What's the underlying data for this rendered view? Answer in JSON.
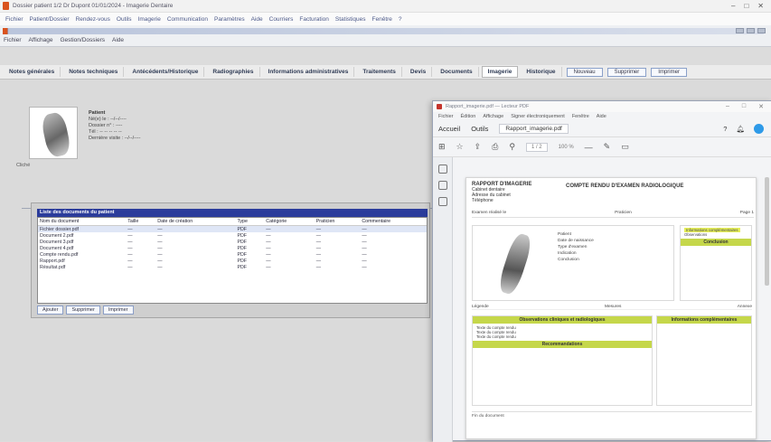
{
  "window": {
    "title": "Dossier patient 1/2 Dr Dupont 01/01/2024 - Imagerie Dentaire",
    "controls": [
      "–",
      "□",
      "✕"
    ]
  },
  "menubar": {
    "items": [
      "Fichier",
      "Patient/Dossier",
      "Rendez-vous",
      "Outils",
      "Imagerie",
      "Communication",
      "Paramètres",
      "Aide",
      "Courriers",
      "Facturation",
      "Statistiques",
      "Fenêtre",
      "?"
    ]
  },
  "toolbar": {
    "submenu": [
      "Fichier",
      "Affichage",
      "Gestion/Dossiers",
      "Aide"
    ]
  },
  "tabs": {
    "items": [
      "Notes générales",
      "Notes techniques",
      "Antécédents/Historique",
      "Radiographies",
      "Informations administratives",
      "Traitements",
      "Devis",
      "Documents",
      "Imagerie",
      "Historique"
    ],
    "buttons": [
      "Nouveau",
      "Supprimer",
      "Imprimer"
    ],
    "active_index": 8
  },
  "patient": {
    "name": "Patient",
    "lines": [
      "Né(e) le : --/--/----",
      "Dossier n° : ----",
      "Tél : -- -- -- -- --",
      "Dernière visite : --/--/----"
    ],
    "photo_caption": "Cliché"
  },
  "documents_panel": {
    "header": "Liste des documents du patient",
    "columns": [
      "Nom du document",
      "Taille",
      "Date de création",
      "Type",
      "Catégorie",
      "Praticien",
      "Commentaire"
    ],
    "rows": [
      [
        "Fichier dossier.pdf",
        "—",
        "—",
        "PDF",
        "—",
        "—",
        "—"
      ],
      [
        "Document 2.pdf",
        "—",
        "—",
        "PDF",
        "—",
        "—",
        "—"
      ],
      [
        "Document 3.pdf",
        "—",
        "—",
        "PDF",
        "—",
        "—",
        "—"
      ],
      [
        "Document 4.pdf",
        "—",
        "—",
        "PDF",
        "—",
        "—",
        "—"
      ],
      [
        "Compte rendu.pdf",
        "—",
        "—",
        "PDF",
        "—",
        "—",
        "—"
      ],
      [
        "Rapport.pdf",
        "—",
        "—",
        "PDF",
        "—",
        "—",
        "—"
      ],
      [
        "Résultat.pdf",
        "—",
        "—",
        "PDF",
        "—",
        "—",
        "—"
      ]
    ],
    "buttons": [
      "Ajouter",
      "Supprimer",
      "Imprimer"
    ]
  },
  "pdf_viewer": {
    "title": "Rapport_imagerie.pdf — Lecteur PDF",
    "menu": [
      "Fichier",
      "Édition",
      "Affichage",
      "Signer électroniquement",
      "Fenêtre",
      "Aide"
    ],
    "tabs": [
      "Accueil",
      "Outils"
    ],
    "doc_tab": "Rapport_imagerie.pdf",
    "page_indicator": "1 / 2",
    "zoom": "100 %",
    "page": {
      "header_title": "RAPPORT D'IMAGERIE",
      "header_lines": [
        "Cabinet dentaire",
        "Adresse du cabinet",
        "Téléphone"
      ],
      "report_title": "COMPTE RENDU D'EXAMEN RADIOLOGIQUE",
      "sub_left": "Examen réalisé le",
      "sub_mid": "Praticien",
      "sub_right": "Page 1",
      "image_lines": [
        "Patient",
        "Date de naissance",
        "Type d'examen",
        "Indication",
        "Conclusion"
      ],
      "side_lines": [
        "Informations complémentaires",
        "Observations"
      ],
      "side_bar": "Conclusion",
      "under_left": "Légende",
      "under_mid": "Mesures",
      "under_right": "Annexe",
      "left_box_title": "Observations cliniques et radiologiques",
      "left_box_lines": [
        "Texte du compte rendu",
        "Texte du compte rendu",
        "Texte du compte rendu"
      ],
      "left_box_title2": "Recommandations",
      "right_box_title": "Informations complémentaires",
      "footer": "Fin du document"
    }
  },
  "colors": {
    "accent_red": "#d9531e",
    "panel_header": "#2b3c9b",
    "highlight": "#c5d74a"
  }
}
